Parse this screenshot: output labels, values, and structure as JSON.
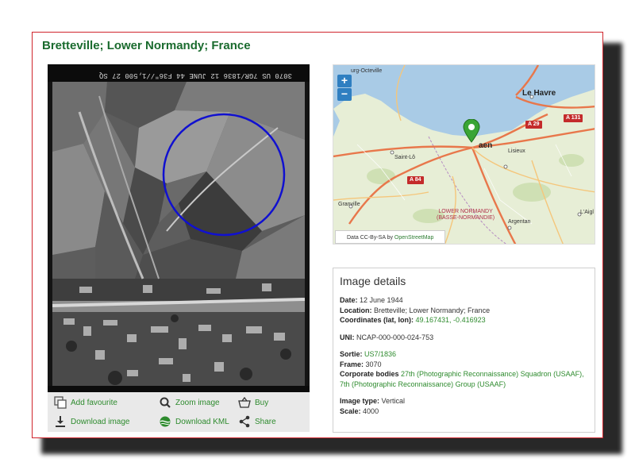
{
  "page": {
    "title": "Bretteville; Lower Normandy; France"
  },
  "photo": {
    "film_caption": "3070 US 7GR/1836 12 JUNE 44 F36\"//1,500 27 SQ",
    "frame_number": "27 SQ"
  },
  "actions": {
    "add_favourite": "Add favourite",
    "zoom_image": "Zoom image",
    "buy": "Buy",
    "download_image": "Download image",
    "download_kml": "Download KML",
    "share": "Share"
  },
  "map": {
    "zoom_in": "+",
    "zoom_out": "−",
    "attribution_prefix": "Data CC-By-SA by",
    "attribution_link": "OpenStreetMap",
    "labels": {
      "cherbourg": "urg-Octeville",
      "le_havre": "Le Havre",
      "caen": "aen",
      "saint_lo": "Saint-Lô",
      "lisieux": "Lisieux",
      "granville": "Granville",
      "argentan": "Argentan",
      "laigle": "L'Aigl",
      "region_line1": "LOWER NORMANDY",
      "region_line2": "(BASSE-NORMANDIE)"
    },
    "roads": {
      "a29": "A 29",
      "a131": "A 131",
      "a84": "A 84"
    },
    "colors": {
      "sea": "#a9cbe6",
      "land": "#e7eed6",
      "major_road": "#e8774b",
      "marker": "#3aa535"
    }
  },
  "details": {
    "heading": "Image details",
    "date_label": "Date:",
    "date_value": "12 June 1944",
    "location_label": "Location:",
    "location_value": "Bretteville; Lower Normandy; France",
    "coords_label": "Coordinates (lat, lon):",
    "coords_value": "49.167431, -0.416923",
    "uni_label": "UNI:",
    "uni_value": "NCAP-000-000-024-753",
    "sortie_label": "Sortie:",
    "sortie_value": "US7/1836",
    "frame_label": "Frame:",
    "frame_value": "3070",
    "corporate_label": "Corporate bodies",
    "corporate_value_1": "27th (Photographic Reconnaissance) Squadron (USAAF),",
    "corporate_value_2": "7th (Photographic Reconnaissance) Group (USAAF)",
    "image_type_label": "Image type:",
    "image_type_value": "Vertical",
    "scale_label": "Scale:",
    "scale_value": "4000"
  },
  "colors": {
    "title_green": "#1a6b2e",
    "link_green": "#2e8b2e",
    "border_red": "#d0252c",
    "circle_blue": "#1010d0"
  }
}
